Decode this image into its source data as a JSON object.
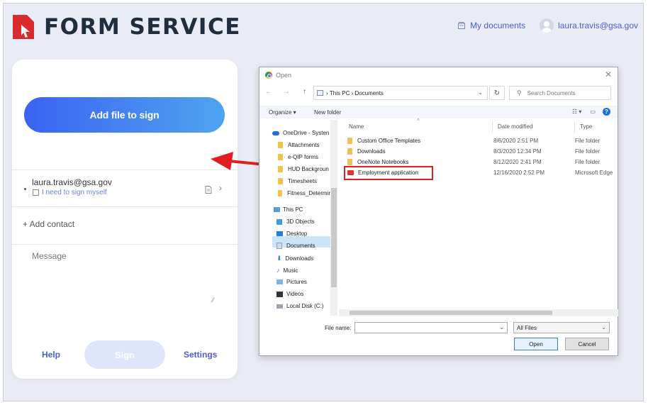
{
  "header": {
    "brand": "FORM SERVICE",
    "my_documents": "My documents",
    "user_email": "laura.travis@gsa.gov"
  },
  "panel": {
    "add_file_label": "Add file to sign",
    "signer_email": "laura.travis@gsa.gov",
    "sign_myself_label": "I need to sign myself",
    "add_contact_label": "+ Add contact",
    "message_placeholder": "Message",
    "help_label": "Help",
    "sign_label": "Sign",
    "settings_label": "Settings"
  },
  "dialog": {
    "title": "Open",
    "breadcrumb": [
      "This PC",
      "Documents"
    ],
    "search_placeholder": "Search Documents",
    "organize_label": "Organize ▾",
    "new_folder_label": "New folder",
    "columns": [
      "Name",
      "Date modified",
      "Type"
    ],
    "nav_items": [
      {
        "label": "OneDrive - Systen",
        "icon": "cloud-icon"
      },
      {
        "label": "Attachments",
        "icon": "folder-icon"
      },
      {
        "label": "e-QIP forms",
        "icon": "folder-icon"
      },
      {
        "label": "HUD Backgroun",
        "icon": "folder-icon"
      },
      {
        "label": "Timesheets",
        "icon": "folder-icon"
      },
      {
        "label": "Fitness_Determir",
        "icon": "folder-icon"
      },
      {
        "label": "This PC",
        "icon": "pc-icon"
      },
      {
        "label": "3D Objects",
        "icon": "cube-icon"
      },
      {
        "label": "Desktop",
        "icon": "desktop-icon"
      },
      {
        "label": "Documents",
        "icon": "documents-icon"
      },
      {
        "label": "Downloads",
        "icon": "download-icon"
      },
      {
        "label": "Music",
        "icon": "music-icon"
      },
      {
        "label": "Pictures",
        "icon": "pictures-icon"
      },
      {
        "label": "Videos",
        "icon": "videos-icon"
      },
      {
        "label": "Local Disk (C:)",
        "icon": "disk-icon"
      }
    ],
    "files": [
      {
        "name": "Custom Office Templates",
        "date": "8/6/2020 2:51 PM",
        "type": "File folder",
        "icon": "folder-icon"
      },
      {
        "name": "Downloads",
        "date": "8/3/2020 12:34 PM",
        "type": "File folder",
        "icon": "folder-icon"
      },
      {
        "name": "OneNote Notebooks",
        "date": "8/12/2020 2:41 PM",
        "type": "File folder",
        "icon": "folder-icon"
      },
      {
        "name": "Employment application",
        "date": "12/16/2020 2:52 PM",
        "type": "Microsoft Edge",
        "icon": "pdf-icon"
      }
    ],
    "file_name_label": "File name:",
    "file_name_value": "",
    "file_type_value": "All Files",
    "open_label": "Open",
    "cancel_label": "Cancel"
  },
  "colors": {
    "brand_dark": "#1f2d3d",
    "brand_red": "#d92b2b",
    "accent_blue": "#4b5dd6",
    "highlight_red": "#e02020"
  }
}
